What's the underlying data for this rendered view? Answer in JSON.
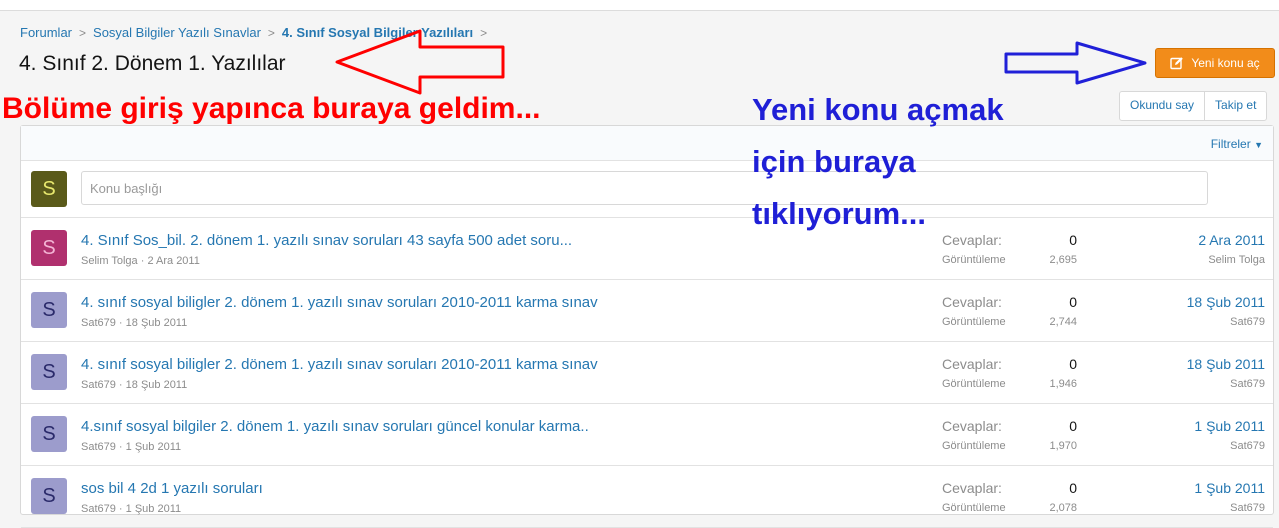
{
  "breadcrumb": {
    "items": [
      "Forumlar",
      "Sosyal Bilgiler Yazılı Sınavlar",
      "4. Sınıf Sosyal Bilgiler Yazılıları"
    ]
  },
  "page": {
    "title": "4. Sınıf 2. Dönem 1. Yazılılar",
    "new_thread_label": "Yeni konu aç",
    "mark_read_label": "Okundu say",
    "watch_label": "Takip et",
    "filters_label": "Filtreler",
    "new_thread_placeholder": "Konu başlığı",
    "current_user_initial": "S"
  },
  "threads": [
    {
      "initial": "S",
      "title": "4. Sınıf Sos_bil. 2. dönem 1. yazılı sınav soruları 43 sayfa 500 adet soru...",
      "author": "Selim Tolga",
      "date": "2 Ara 2011",
      "replies_label": "Cevaplar:",
      "replies": "0",
      "views_label": "Görüntüleme",
      "views": "2,695",
      "last_date": "2 Ara 2011",
      "last_user": "Selim Tolga"
    },
    {
      "initial": "S",
      "title": "4. sınıf sosyal biligler 2. dönem 1. yazılı sınav soruları 2010-2011 karma sınav",
      "author": "Sat679",
      "date": "18 Şub 2011",
      "replies_label": "Cevaplar:",
      "replies": "0",
      "views_label": "Görüntüleme",
      "views": "2,744",
      "last_date": "18 Şub 2011",
      "last_user": "Sat679"
    },
    {
      "initial": "S",
      "title": "4. sınıf sosyal biligler 2. dönem 1. yazılı sınav soruları 2010-2011 karma sınav",
      "author": "Sat679",
      "date": "18 Şub 2011",
      "replies_label": "Cevaplar:",
      "replies": "0",
      "views_label": "Görüntüleme",
      "views": "1,946",
      "last_date": "18 Şub 2011",
      "last_user": "Sat679"
    },
    {
      "initial": "S",
      "title": "4.sınıf sosyal bilgiler 2. dönem 1. yazılı sınav soruları güncel konular karma..",
      "author": "Sat679",
      "date": "1 Şub 2011",
      "replies_label": "Cevaplar:",
      "replies": "0",
      "views_label": "Görüntüleme",
      "views": "1,970",
      "last_date": "1 Şub 2011",
      "last_user": "Sat679"
    },
    {
      "initial": "S",
      "title": "sos bil 4 2d 1 yazılı soruları",
      "author": "Sat679",
      "date": "1 Şub 2011",
      "replies_label": "Cevaplar:",
      "replies": "0",
      "views_label": "Görüntüleme",
      "views": "2,078",
      "last_date": "1 Şub 2011",
      "last_user": "Sat679"
    }
  ],
  "annotations": {
    "red": "Bölüme giriş yapınca buraya geldim...",
    "blue_lines": [
      "Yeni konu açmak",
      "için buraya",
      "tıklıyorum..."
    ]
  },
  "colors": {
    "link": "#2577b1",
    "accent_button": "#f28c1a",
    "annotation_red": "#ff0000",
    "annotation_blue": "#1f1fd6"
  }
}
